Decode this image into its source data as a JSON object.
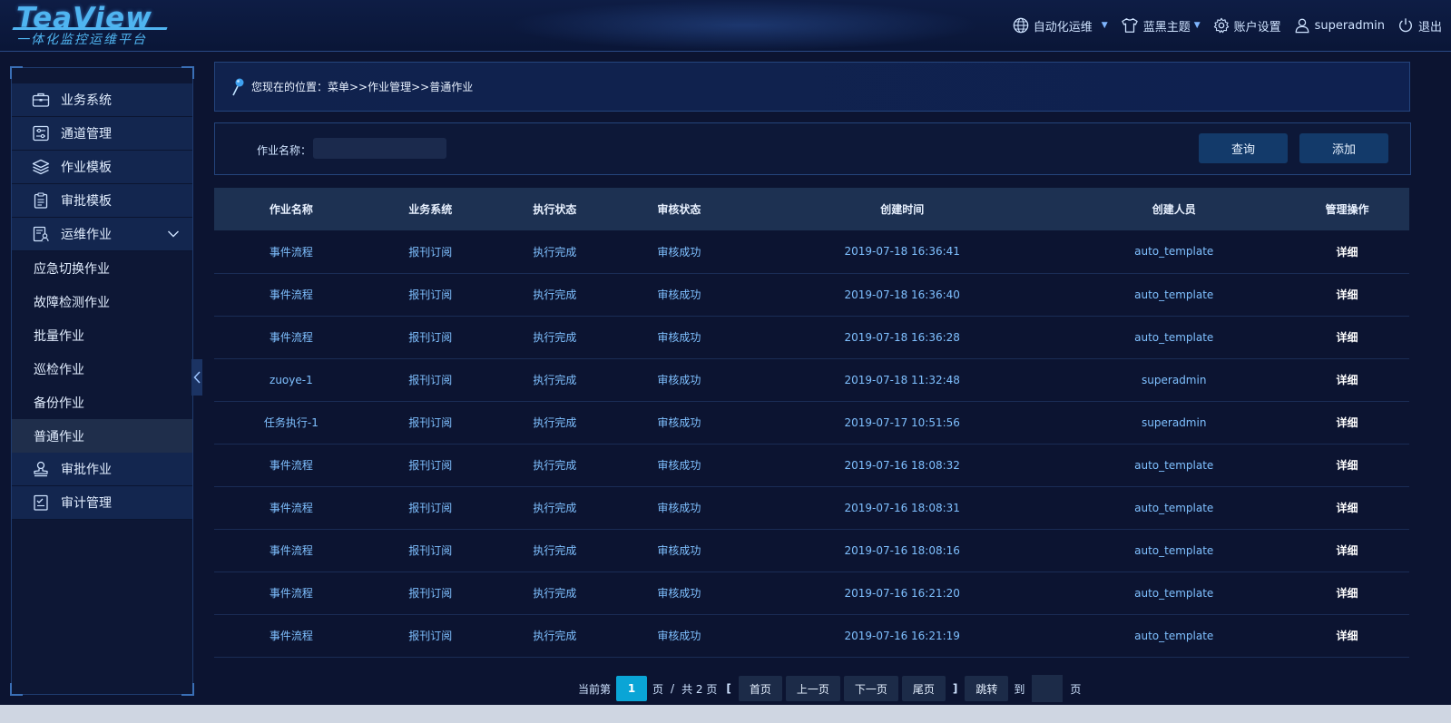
{
  "brand": {
    "title": "TeaView",
    "subtitle": "一体化监控运维平台"
  },
  "topnav": {
    "automation": "自动化运维",
    "theme": "蓝黑主题",
    "settings": "账户设置",
    "user": "superadmin",
    "logout": "退出"
  },
  "sidebar": {
    "items": [
      {
        "label": "业务系统",
        "icon": "briefcase-icon"
      },
      {
        "label": "通道管理",
        "icon": "sliders-icon"
      },
      {
        "label": "作业模板",
        "icon": "layers-icon"
      },
      {
        "label": "审批模板",
        "icon": "clipboard-icon"
      },
      {
        "label": "运维作业",
        "icon": "user-doc-icon"
      }
    ],
    "sub_items": [
      "应急切换作业",
      "故障检测作业",
      "批量作业",
      "巡检作业",
      "备份作业",
      "普通作业"
    ],
    "items_after": [
      {
        "label": "审批作业",
        "icon": "stamp-icon"
      },
      {
        "label": "审计管理",
        "icon": "checklist-icon"
      }
    ]
  },
  "breadcrumb": {
    "text": "您现在的位置：菜单>>作业管理>>普通作业"
  },
  "search": {
    "label": "作业名称：",
    "value": "",
    "query_button": "查询",
    "add_button": "添加"
  },
  "table": {
    "columns": [
      "作业名称",
      "业务系统",
      "执行状态",
      "审核状态",
      "创建时间",
      "创建人员",
      "管理操作"
    ],
    "rows": [
      [
        "事件流程",
        "报刊订阅",
        "执行完成",
        "审核成功",
        "2019-07-18 16:36:41",
        "auto_template",
        "详细"
      ],
      [
        "事件流程",
        "报刊订阅",
        "执行完成",
        "审核成功",
        "2019-07-18 16:36:40",
        "auto_template",
        "详细"
      ],
      [
        "事件流程",
        "报刊订阅",
        "执行完成",
        "审核成功",
        "2019-07-18 16:36:28",
        "auto_template",
        "详细"
      ],
      [
        "zuoye-1",
        "报刊订阅",
        "执行完成",
        "审核成功",
        "2019-07-18 11:32:48",
        "superadmin",
        "详细"
      ],
      [
        "任务执行-1",
        "报刊订阅",
        "执行完成",
        "审核成功",
        "2019-07-17 10:51:56",
        "superadmin",
        "详细"
      ],
      [
        "事件流程",
        "报刊订阅",
        "执行完成",
        "审核成功",
        "2019-07-16 18:08:32",
        "auto_template",
        "详细"
      ],
      [
        "事件流程",
        "报刊订阅",
        "执行完成",
        "审核成功",
        "2019-07-16 18:08:31",
        "auto_template",
        "详细"
      ],
      [
        "事件流程",
        "报刊订阅",
        "执行完成",
        "审核成功",
        "2019-07-16 18:08:16",
        "auto_template",
        "详细"
      ],
      [
        "事件流程",
        "报刊订阅",
        "执行完成",
        "审核成功",
        "2019-07-16 16:21:20",
        "auto_template",
        "详细"
      ],
      [
        "事件流程",
        "报刊订阅",
        "执行完成",
        "审核成功",
        "2019-07-16 16:21:19",
        "auto_template",
        "详细"
      ]
    ]
  },
  "pager": {
    "current_label": "当前第",
    "current_page": "1",
    "page_unit": "页",
    "sep": "/",
    "total_label": "共 2 页",
    "first": "首页",
    "prev": "上一页",
    "next": "下一页",
    "last": "尾页",
    "jump": "跳转",
    "to_label": "到",
    "to_unit": "页",
    "open_bracket": "[",
    "close_bracket": "]"
  },
  "colors": {
    "accent": "#0aa5d6",
    "link": "#7fc0ff",
    "background": "#0c1431"
  }
}
